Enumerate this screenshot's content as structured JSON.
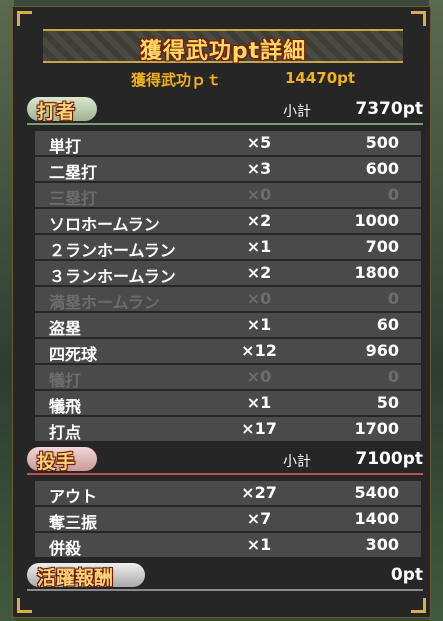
{
  "title": "獲得武功pt詳細",
  "total": {
    "label": "獲得武功ｐｔ",
    "value": "14470pt"
  },
  "batter": {
    "title": "打者",
    "subtotal_label": "小計",
    "subtotal_value": "7370pt",
    "rows": [
      {
        "name": "単打",
        "count": "×5",
        "points": "500",
        "dim": false
      },
      {
        "name": "二塁打",
        "count": "×3",
        "points": "600",
        "dim": false
      },
      {
        "name": "三塁打",
        "count": "×0",
        "points": "0",
        "dim": true
      },
      {
        "name": "ソロホームラン",
        "count": "×2",
        "points": "1000",
        "dim": false
      },
      {
        "name": "２ランホームラン",
        "count": "×1",
        "points": "700",
        "dim": false
      },
      {
        "name": "３ランホームラン",
        "count": "×2",
        "points": "1800",
        "dim": false
      },
      {
        "name": "満塁ホームラン",
        "count": "×0",
        "points": "0",
        "dim": true
      },
      {
        "name": "盗塁",
        "count": "×1",
        "points": "60",
        "dim": false
      },
      {
        "name": "四死球",
        "count": "×12",
        "points": "960",
        "dim": false
      },
      {
        "name": "犠打",
        "count": "×0",
        "points": "0",
        "dim": true
      },
      {
        "name": "犠飛",
        "count": "×1",
        "points": "50",
        "dim": false
      },
      {
        "name": "打点",
        "count": "×17",
        "points": "1700",
        "dim": false
      }
    ]
  },
  "pitcher": {
    "title": "投手",
    "subtotal_label": "小計",
    "subtotal_value": "7100pt",
    "rows": [
      {
        "name": "アウト",
        "count": "×27",
        "points": "5400",
        "dim": false
      },
      {
        "name": "奪三振",
        "count": "×7",
        "points": "1400",
        "dim": false
      },
      {
        "name": "併殺",
        "count": "×1",
        "points": "300",
        "dim": false
      }
    ]
  },
  "bonus": {
    "title": "活躍報酬",
    "value": "0pt"
  }
}
